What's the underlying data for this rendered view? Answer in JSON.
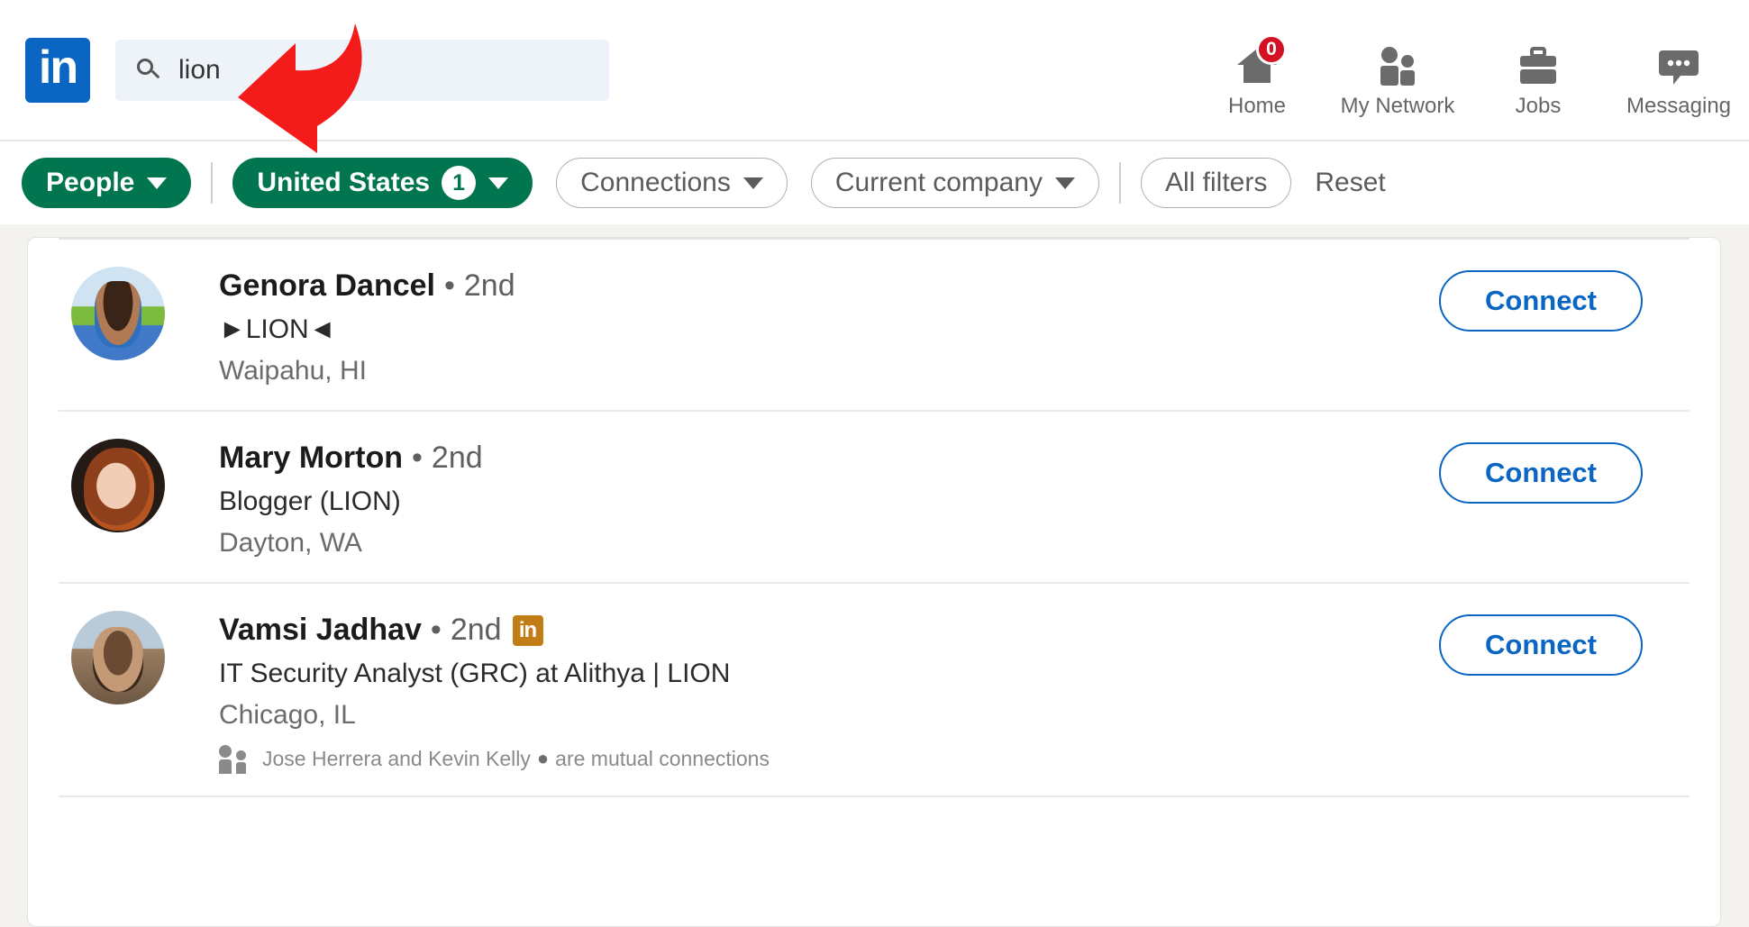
{
  "topnav": {
    "logo_text": "in",
    "logo_name": "linkedin-logo",
    "search": {
      "value": "lion",
      "placeholder": "Search"
    },
    "items": [
      {
        "label": "Home",
        "icon": "home-icon",
        "badge": "0"
      },
      {
        "label": "My Network",
        "icon": "my-network-icon",
        "badge": ""
      },
      {
        "label": "Jobs",
        "icon": "briefcase-icon",
        "badge": ""
      },
      {
        "label": "Messaging",
        "icon": "messaging-icon",
        "badge": ""
      }
    ]
  },
  "annotation": {
    "type": "red-arrow",
    "color": "#f41b1b",
    "points_to": "search-input"
  },
  "filters": {
    "pills": [
      {
        "label": "People",
        "style": "green",
        "count": "",
        "caret": true
      },
      {
        "label": "United States",
        "style": "green",
        "count": "1",
        "caret": true
      },
      {
        "label": "Connections",
        "style": "plain",
        "count": "",
        "caret": true
      },
      {
        "label": "Current company",
        "style": "plain",
        "count": "",
        "caret": true
      },
      {
        "label": "All filters",
        "style": "plain",
        "count": "",
        "caret": false
      }
    ],
    "reset_label": "Reset"
  },
  "results": [
    {
      "name": "Genora Dancel",
      "separator": "•",
      "degree": "2nd",
      "premium": false,
      "headline": "►LION◄",
      "location": "Waipahu, HI",
      "mutual": null,
      "action_label": "Connect",
      "avatar": "av1"
    },
    {
      "name": "Mary Morton",
      "separator": "•",
      "degree": "2nd",
      "premium": false,
      "headline": "Blogger (LION)",
      "location": "Dayton, WA",
      "mutual": null,
      "action_label": "Connect",
      "avatar": "av2"
    },
    {
      "name": "Vamsi Jadhav",
      "separator": "•",
      "degree": "2nd",
      "premium": true,
      "premium_badge_text": "in",
      "headline": "IT Security Analyst (GRC) at Alithya | LION",
      "location": "Chicago, IL",
      "mutual": {
        "names": "Jose Herrera and Kevin Kelly",
        "suffix": "are mutual connections"
      },
      "action_label": "Connect",
      "avatar": "av3"
    }
  ],
  "colors": {
    "linkedin_blue": "#0a66c2",
    "filter_green": "#01754f",
    "premium_gold": "#c37d16",
    "annotation_red": "#f41b1b",
    "page_bg": "#f3f2ef"
  }
}
